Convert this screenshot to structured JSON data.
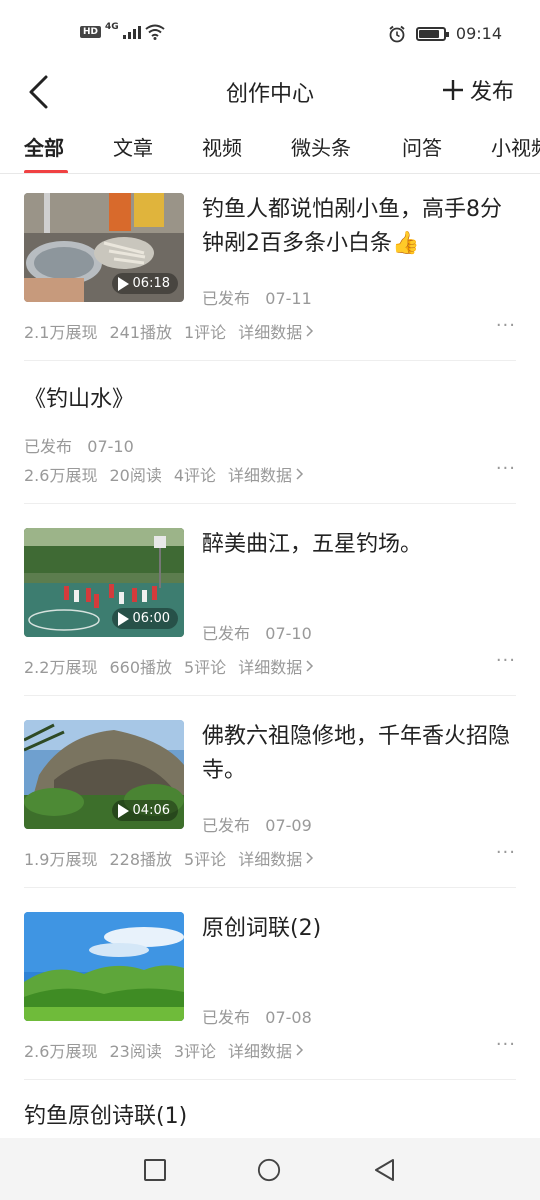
{
  "status_bar": {
    "hd": "HD",
    "network": "4G",
    "battery_level": 0.85,
    "time": "09:14"
  },
  "header": {
    "title": "创作中心",
    "publish_label": "发布"
  },
  "tabs": [
    {
      "label": "全部",
      "active": true
    },
    {
      "label": "文章",
      "active": false
    },
    {
      "label": "视频",
      "active": false
    },
    {
      "label": "微头条",
      "active": false
    },
    {
      "label": "问答",
      "active": false
    },
    {
      "label": "小视频",
      "active": false
    }
  ],
  "items": [
    {
      "title": "钓鱼人都说怕剐小鱼，高手8分钟剐2百多条小白条👍",
      "status": "已发布",
      "date": "07-11",
      "duration": "06:18",
      "stats": [
        "2.1万展现",
        "241播放",
        "1评论"
      ],
      "detail": "详细数据"
    },
    {
      "title": "《钓山水》",
      "status": "已发布",
      "date": "07-10",
      "stats": [
        "2.6万展现",
        "20阅读",
        "4评论"
      ],
      "detail": "详细数据"
    },
    {
      "title": "醉美曲江，五星钓场。",
      "status": "已发布",
      "date": "07-10",
      "duration": "06:00",
      "stats": [
        "2.2万展现",
        "660播放",
        "5评论"
      ],
      "detail": "详细数据"
    },
    {
      "title": "佛教六祖隐修地，千年香火招隐寺。",
      "status": "已发布",
      "date": "07-09",
      "duration": "04:06",
      "stats": [
        "1.9万展现",
        "228播放",
        "5评论"
      ],
      "detail": "详细数据"
    },
    {
      "title": "原创词联(2)",
      "status": "已发布",
      "date": "07-08",
      "stats": [
        "2.6万展现",
        "23阅读",
        "3评论"
      ],
      "detail": "详细数据"
    },
    {
      "title": "钓鱼原创诗联(1)"
    }
  ],
  "colors": {
    "accent": "#f04142",
    "muted": "#999999",
    "text": "#222222"
  }
}
